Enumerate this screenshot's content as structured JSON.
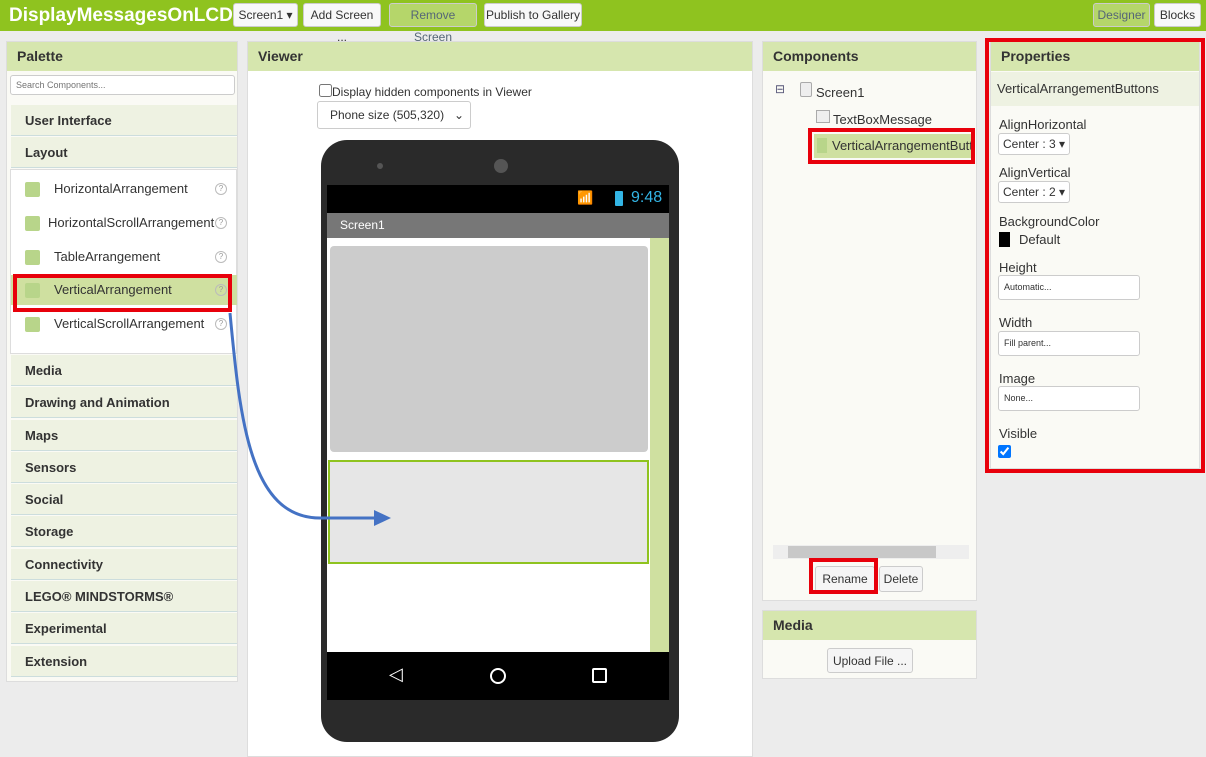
{
  "app": {
    "title": "DisplayMessagesOnLCD",
    "screen_select": "Screen1 ▾",
    "add_screen": "Add Screen ...",
    "remove_screen": "Remove Screen",
    "publish": "Publish to Gallery",
    "designer": "Designer",
    "blocks": "Blocks"
  },
  "palette": {
    "title": "Palette",
    "search_placeholder": "Search Components...",
    "categories_top": [
      "User Interface",
      "Layout"
    ],
    "layout_items": [
      "HorizontalArrangement",
      "HorizontalScrollArrangement",
      "TableArrangement",
      "VerticalArrangement",
      "VerticalScrollArrangement"
    ],
    "categories_bottom": [
      "Media",
      "Drawing and Animation",
      "Maps",
      "Sensors",
      "Social",
      "Storage",
      "Connectivity",
      "LEGO® MINDSTORMS®",
      "Experimental",
      "Extension"
    ],
    "help": "?"
  },
  "viewer": {
    "title": "Viewer",
    "hidden_label": "Display hidden components in Viewer",
    "hidden_checked": false,
    "phone_size": "Phone size (505,320)",
    "time": "9:48",
    "screen_title": "Screen1"
  },
  "components": {
    "title": "Components",
    "tree": [
      "Screen1",
      "TextBoxMessage",
      "VerticalArrangementButtons"
    ],
    "rename": "Rename",
    "delete": "Delete",
    "collapse": "⊟"
  },
  "media": {
    "title": "Media",
    "upload": "Upload File ..."
  },
  "properties": {
    "title": "Properties",
    "component": "VerticalArrangementButtons",
    "align_h_label": "AlignHorizontal",
    "align_h": "Center : 3 ▾",
    "align_v_label": "AlignVertical",
    "align_v": "Center : 2 ▾",
    "bg_label": "BackgroundColor",
    "bg": "Default",
    "bg_color": "#000000",
    "height_label": "Height",
    "height": "Automatic...",
    "width_label": "Width",
    "width": "Fill parent...",
    "image_label": "Image",
    "image": "None...",
    "visible_label": "Visible",
    "visible": true
  },
  "colors": {
    "brand": "#8fc31f",
    "highlight": "#e8000b",
    "arrow": "#4472c4"
  }
}
